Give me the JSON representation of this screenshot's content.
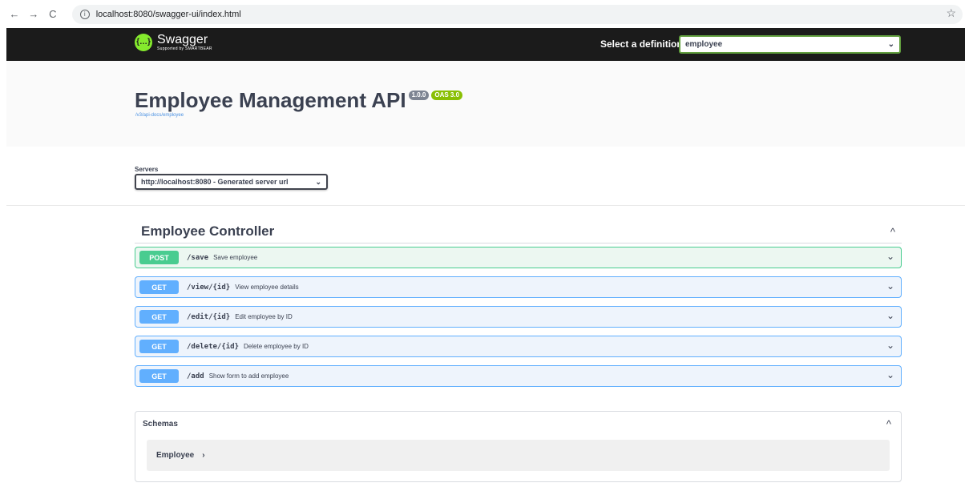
{
  "browser": {
    "back": "←",
    "forward": "→",
    "reload": "C",
    "info": "i",
    "url": "localhost:8080/swagger-ui/index.html",
    "star": "☆"
  },
  "topbar": {
    "logo_title": "Swagger",
    "logo_sub": "Supported by SMARTBEAR",
    "definition_label": "Select a definition",
    "definition_value": "employee",
    "select_caret": "⌄"
  },
  "info": {
    "title": "Employee Management API",
    "version": "1.0.0",
    "oas": "OAS 3.0",
    "docs_link": "/v3/api-docs/employee"
  },
  "servers": {
    "label": "Servers",
    "selected": "http://localhost:8080 - Generated server url",
    "caret": "⌄"
  },
  "tag": {
    "title": "Employee Controller",
    "caret": "^"
  },
  "operations": [
    {
      "method": "POST",
      "path": "/save",
      "summary": "Save employee",
      "chevron": "⌄"
    },
    {
      "method": "GET",
      "path": "/view/{id}",
      "summary": "View employee details",
      "chevron": "⌄"
    },
    {
      "method": "GET",
      "path": "/edit/{id}",
      "summary": "Edit employee by ID",
      "chevron": "⌄"
    },
    {
      "method": "GET",
      "path": "/delete/{id}",
      "summary": "Delete employee by ID",
      "chevron": "⌄"
    },
    {
      "method": "GET",
      "path": "/add",
      "summary": "Show form to add employee",
      "chevron": "⌄"
    }
  ],
  "schemas": {
    "title": "Schemas",
    "caret": "^",
    "items": [
      {
        "name": "Employee",
        "arrow": "›"
      }
    ]
  },
  "colors": {
    "post": "#49cc90",
    "get": "#61affe",
    "topbar": "#1b1b1b",
    "swagger_green": "#85ea2d"
  }
}
